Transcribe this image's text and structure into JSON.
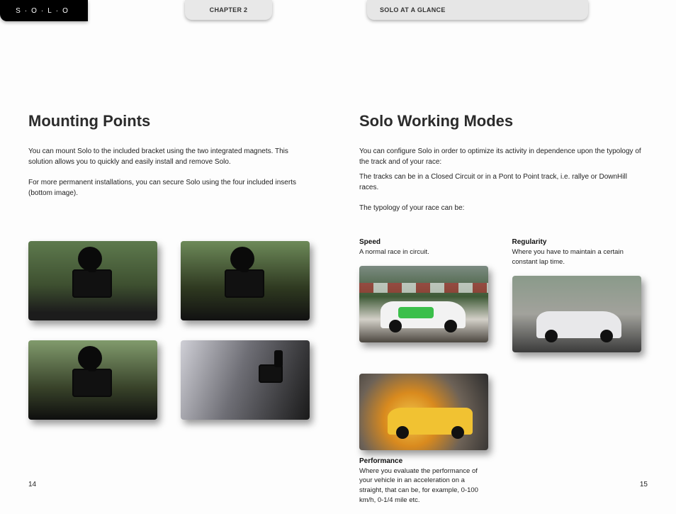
{
  "tabs": {
    "chapter": "CHAPTER 2",
    "section": "SOLO AT A GLANCE",
    "brand": "S·O·L·O"
  },
  "leftPage": {
    "heading": "Mounting Points",
    "para1": "You can mount Solo to the included bracket using the two integrated magnets. This solution allows you to quickly and easily install and remove Solo.",
    "para2": "For more permanent installations, you can secure Solo using the four included inserts (bottom image).",
    "pageNumber": "14"
  },
  "rightPage": {
    "heading": "Solo Working Modes",
    "para1": "You can configure Solo in order to  optimize its activity in dependence upon the typology of the track and of your race:",
    "para2": "The tracks can be in a Closed Circuit or in a Pont to Point track, i.e. rallye or DownHill races.",
    "para3": "The typology of your race can be:",
    "pageNumber": "15"
  },
  "modes": {
    "speed": {
      "title": "Speed",
      "desc": "A normal race in circuit."
    },
    "regularity": {
      "title": "Regularity",
      "desc": "Where you have to maintain a certain constant lap time."
    },
    "performance": {
      "title": "Performance",
      "desc": "Where you evaluate the performance of your vehicle in an acceleration on a straight, that can be, for example, 0-100 km/h, 0-1/4 mile etc."
    }
  }
}
